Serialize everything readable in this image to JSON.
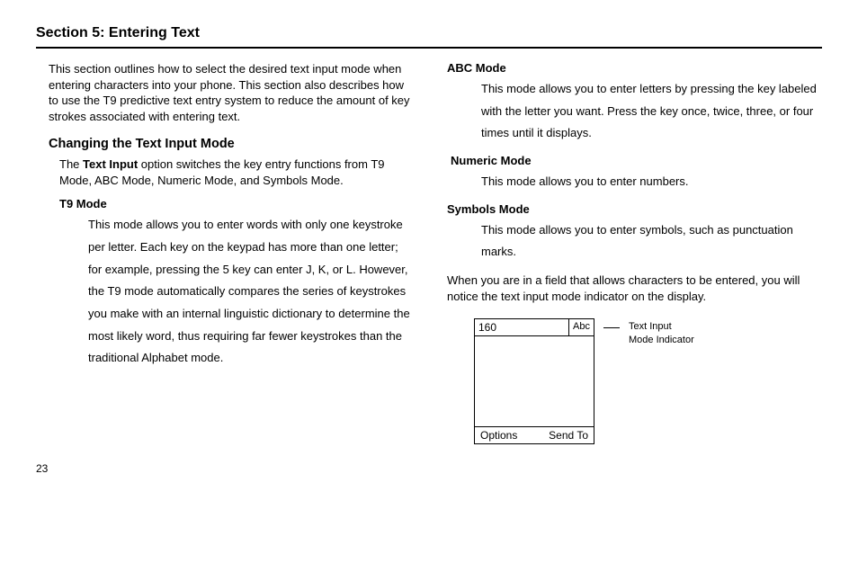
{
  "section_title": "Section 5: Entering Text",
  "intro": "This section outlines how to select the desired text input mode when entering characters into your phone. This section also describes how to use the T9 predictive text entry system to reduce the amount of key strokes associated with entering text.",
  "changing_heading": "Changing the Text Input Mode",
  "changing_para_pre": "The ",
  "changing_para_bold": "Text Input",
  "changing_para_post": " option switches the key entry functions from T9 Mode, ABC Mode, Numeric Mode, and Symbols Mode.",
  "t9_heading": "T9 Mode",
  "t9_desc": "This mode allows you to enter words with only one keystroke per letter. Each key on the keypad has more than one letter; for example, pressing the 5 key can enter J, K, or L. However, the T9 mode automatically compares the series of keystrokes you make with an internal linguistic dictionary to determine the most likely word, thus requiring far fewer keystrokes than the traditional Alphabet mode.",
  "abc_heading": "ABC Mode",
  "abc_desc": "This mode allows you to enter letters by pressing the key labeled with the letter you want. Press the key once, twice, three, or four times until it displays.",
  "numeric_heading": "Numeric Mode",
  "numeric_desc": "This mode allows you to enter numbers.",
  "symbols_heading": "Symbols Mode",
  "symbols_desc": "This mode allows you to enter symbols, such as punctuation marks.",
  "closing": "When you are in a field that allows characters to be entered, you will notice the text input mode indicator on the display.",
  "phone": {
    "count": "160",
    "mode": "Abc",
    "options": "Options",
    "send_to": "Send To",
    "callout_line1": "Text Input",
    "callout_line2": "Mode Indicator"
  },
  "page_number": "23"
}
